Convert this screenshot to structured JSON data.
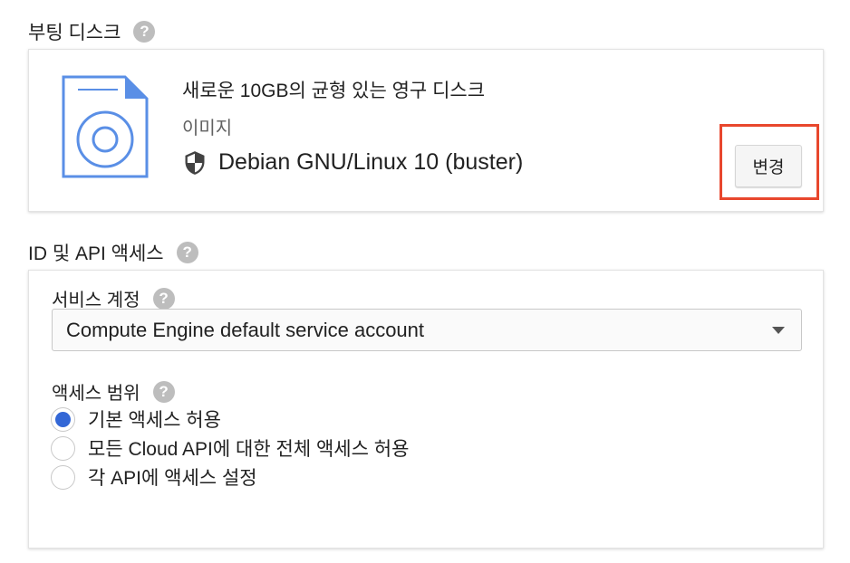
{
  "boot_disk": {
    "section_title": "부팅 디스크",
    "disk_title": "새로운 10GB의 균형 있는 영구 디스크",
    "image_label": "이미지",
    "os_name": "Debian GNU/Linux 10 (buster)",
    "change_button": "변경"
  },
  "identity_api": {
    "section_title": "ID 및 API 액세스",
    "service_account": {
      "label": "서비스 계정",
      "selected": "Compute Engine default service account"
    },
    "access_scopes": {
      "label": "액세스 범위",
      "options": [
        {
          "label": "기본 액세스 허용",
          "checked": true
        },
        {
          "label": "모든 Cloud API에 대한 전체 액세스 허용",
          "checked": false
        },
        {
          "label": "각 API에 액세스 설정",
          "checked": false
        }
      ]
    }
  },
  "help_glyph": "?",
  "colors": {
    "accent": "#3367d6",
    "highlight": "#e8472d",
    "disk_icon": "#5a8fe6"
  }
}
